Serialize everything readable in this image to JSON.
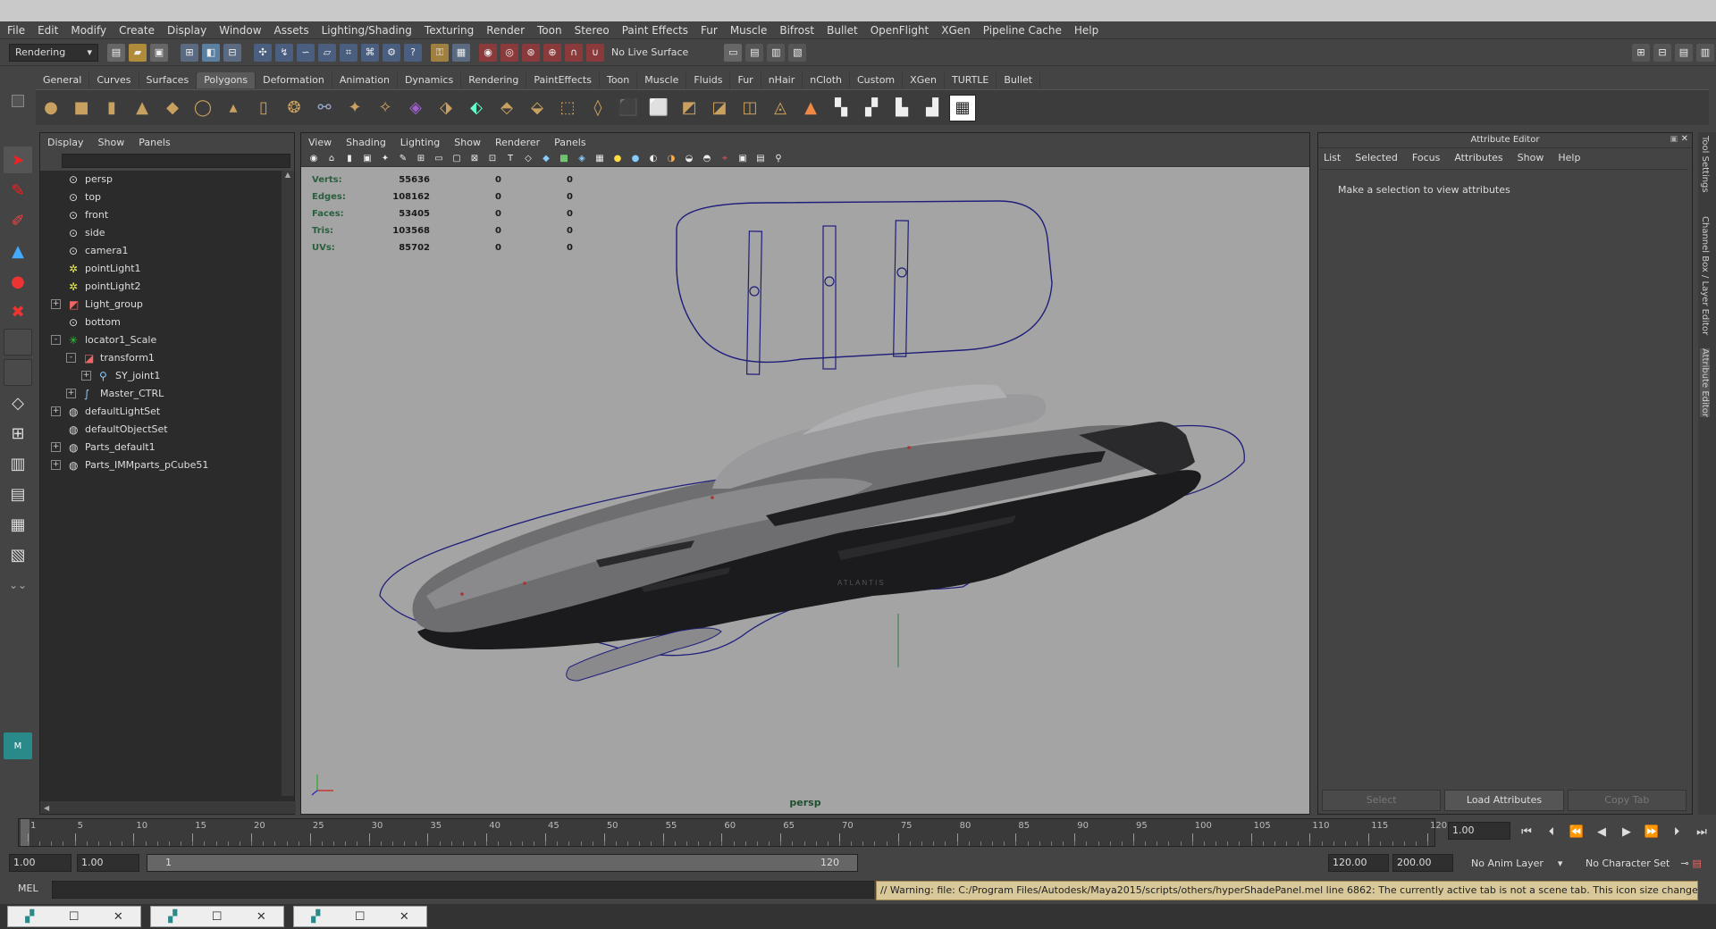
{
  "colors": {
    "viewport_bg": "#a4a4a4",
    "panel_bg": "#444444",
    "outliner_bg": "#2b2b2b",
    "hud_label": "#2a5f3e",
    "warning_bg": "#d8c89a",
    "wire_blue": "#1e1e7a"
  },
  "menubar": [
    "File",
    "Edit",
    "Modify",
    "Create",
    "Display",
    "Window",
    "Assets",
    "Lighting/Shading",
    "Texturing",
    "Render",
    "Toon",
    "Stereo",
    "Paint Effects",
    "Fur",
    "Muscle",
    "Bifrost",
    "Bullet",
    "OpenFlight",
    "XGen",
    "Pipeline Cache",
    "Help"
  ],
  "statusline": {
    "menuset": "Rendering",
    "live_surface": "No Live Surface"
  },
  "shelf": {
    "tabs": [
      "General",
      "Curves",
      "Surfaces",
      "Polygons",
      "Deformation",
      "Animation",
      "Dynamics",
      "Rendering",
      "PaintEffects",
      "Toon",
      "Muscle",
      "Fluids",
      "Fur",
      "nHair",
      "nCloth",
      "Custom",
      "XGen",
      "TURTLE",
      "Bullet"
    ],
    "active_tab": "Polygons"
  },
  "outliner": {
    "menu": [
      "Display",
      "Show",
      "Panels"
    ],
    "nodes": [
      {
        "label": "persp",
        "icon": "camera-icon",
        "indent": 0,
        "expander": ""
      },
      {
        "label": "top",
        "icon": "camera-icon",
        "indent": 0,
        "expander": ""
      },
      {
        "label": "front",
        "icon": "camera-icon",
        "indent": 0,
        "expander": ""
      },
      {
        "label": "side",
        "icon": "camera-icon",
        "indent": 0,
        "expander": ""
      },
      {
        "label": "camera1",
        "icon": "camera-icon",
        "indent": 0,
        "expander": ""
      },
      {
        "label": "pointLight1",
        "icon": "point-light-icon",
        "indent": 0,
        "expander": ""
      },
      {
        "label": "pointLight2",
        "icon": "point-light-icon",
        "indent": 0,
        "expander": ""
      },
      {
        "label": "Light_group",
        "icon": "group-icon",
        "indent": 0,
        "expander": "+"
      },
      {
        "label": "bottom",
        "icon": "camera-icon",
        "indent": 0,
        "expander": ""
      },
      {
        "label": "locator1_Scale",
        "icon": "locator-icon",
        "indent": 0,
        "expander": "-"
      },
      {
        "label": "transform1",
        "icon": "transform-icon",
        "indent": 1,
        "expander": "-"
      },
      {
        "label": "SY_joint1",
        "icon": "joint-icon",
        "indent": 2,
        "expander": "+"
      },
      {
        "label": "Master_CTRL",
        "icon": "curve-icon",
        "indent": 1,
        "expander": "+"
      },
      {
        "label": "defaultLightSet",
        "icon": "set-icon",
        "indent": 0,
        "expander": "+"
      },
      {
        "label": "defaultObjectSet",
        "icon": "set-icon",
        "indent": 0,
        "expander": ""
      },
      {
        "label": "Parts_default1",
        "icon": "set-icon",
        "indent": 0,
        "expander": "+"
      },
      {
        "label": "Parts_IMMparts_pCube51",
        "icon": "set-icon",
        "indent": 0,
        "expander": "+"
      }
    ]
  },
  "viewport": {
    "menu": [
      "View",
      "Shading",
      "Lighting",
      "Show",
      "Renderer",
      "Panels"
    ],
    "camera": "persp",
    "hud": [
      {
        "label": "Verts:",
        "a": "55636",
        "b": "0",
        "c": "0"
      },
      {
        "label": "Edges:",
        "a": "108162",
        "b": "0",
        "c": "0"
      },
      {
        "label": "Faces:",
        "a": "53405",
        "b": "0",
        "c": "0"
      },
      {
        "label": "Tris:",
        "a": "103568",
        "b": "0",
        "c": "0"
      },
      {
        "label": "UVs:",
        "a": "85702",
        "b": "0",
        "c": "0"
      }
    ],
    "model_text": "ATLANTIS"
  },
  "attribute_editor": {
    "title": "Attribute Editor",
    "menu": [
      "List",
      "Selected",
      "Focus",
      "Attributes",
      "Show",
      "Help"
    ],
    "message": "Make a selection to view attributes",
    "buttons": {
      "select": "Select",
      "load": "Load Attributes",
      "copy": "Copy Tab"
    }
  },
  "side_tabs": [
    "Tool Settings",
    "Channel Box / Layer Editor",
    "Attribute Editor"
  ],
  "timeline": {
    "ticks": [
      1,
      5,
      10,
      15,
      20,
      25,
      30,
      35,
      40,
      45,
      50,
      55,
      60,
      65,
      70,
      75,
      80,
      85,
      90,
      95,
      100,
      105,
      110,
      115,
      120
    ],
    "start": 1,
    "end": 120,
    "current_frame": "1.00"
  },
  "range": {
    "anim_start": "1.00",
    "playback_start": "1.00",
    "slider_start": "1",
    "slider_end": "120",
    "playback_end": "120.00",
    "anim_end": "200.00",
    "anim_layer": "No Anim Layer",
    "character_set": "No Character Set"
  },
  "command": {
    "label": "MEL",
    "warning": "// Warning: file: C:/Program Files/Autodesk/Maya2015/scripts/others/hyperShadePanel.mel line 6862: The currently active tab is not a scene tab.  This icon size change operation is not implemented"
  }
}
